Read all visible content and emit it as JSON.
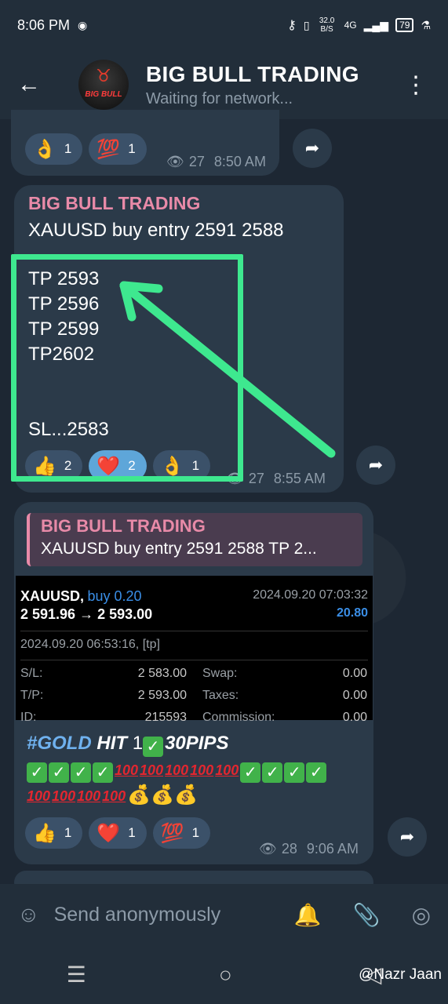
{
  "status_bar": {
    "time": "8:06 PM",
    "net_speed": "32.0 B/S",
    "signal": "4G",
    "battery": "79"
  },
  "header": {
    "title": "BIG BULL TRADING",
    "status": "Waiting for network...",
    "avatar_text": "BIG BULL"
  },
  "msg1": {
    "reactions": [
      {
        "emoji": "👌",
        "count": "1"
      },
      {
        "emoji": "💯",
        "count": "1"
      }
    ],
    "views": "27",
    "time": "8:50 AM"
  },
  "msg2": {
    "sender": "BIG BULL TRADING",
    "line1": "XAUUSD buy entry 2591 2588",
    "tp_lines": [
      "TP 2593",
      "TP 2596",
      "TP 2599",
      "TP2602"
    ],
    "sl": "SL...2583",
    "reactions": [
      {
        "emoji": "👍",
        "count": "2"
      },
      {
        "emoji": "❤️",
        "count": "2"
      },
      {
        "emoji": "👌",
        "count": "1"
      }
    ],
    "views": "27",
    "time": "8:55 AM"
  },
  "msg3": {
    "quote_sender": "BIG BULL TRADING",
    "quote_text": "XAUUSD buy entry 2591 2588  TP 2...",
    "trade": {
      "symbol": "XAUUSD,",
      "direction": "buy 0.20",
      "open_time": "2024.09.20 07:03:32",
      "prices": "2 591.96 → 2 593.00",
      "profit": "20.80",
      "close_time": "2024.09.20 06:53:16, [tp]",
      "sl_label": "S/L:",
      "sl_value": "2 583.00",
      "swap_label": "Swap:",
      "swap_value": "0.00",
      "tp_label": "T/P:",
      "tp_value": "2 593.00",
      "taxes_label": "Taxes:",
      "taxes_value": "0.00",
      "id_label": "ID:",
      "id_value": "215593",
      "commission_label": "Commission:",
      "commission_value": "0.00"
    },
    "gold_tag": "#GOLD",
    "gold_hit": "HIT",
    "gold_pre": "1",
    "gold_pips": "30PIPS",
    "reactions": [
      {
        "emoji": "👍",
        "count": "1"
      },
      {
        "emoji": "❤️",
        "count": "1"
      },
      {
        "emoji": "💯",
        "count": "1"
      }
    ],
    "views": "28",
    "time": "9:06 AM"
  },
  "input": {
    "placeholder": "Send anonymously"
  },
  "watermark": "@Nazr Jaan",
  "colors": {
    "highlight": "#3ee88f",
    "sender": "#e88aa8",
    "bubble": "#2b3a49"
  }
}
